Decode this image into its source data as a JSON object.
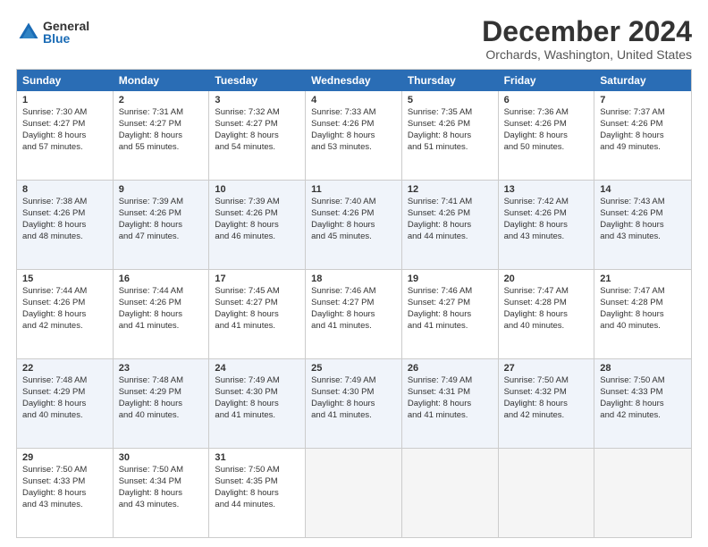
{
  "logo": {
    "general": "General",
    "blue": "Blue"
  },
  "title": "December 2024",
  "subtitle": "Orchards, Washington, United States",
  "header_days": [
    "Sunday",
    "Monday",
    "Tuesday",
    "Wednesday",
    "Thursday",
    "Friday",
    "Saturday"
  ],
  "rows": [
    [
      {
        "day": "1",
        "lines": [
          "Sunrise: 7:30 AM",
          "Sunset: 4:27 PM",
          "Daylight: 8 hours",
          "and 57 minutes."
        ]
      },
      {
        "day": "2",
        "lines": [
          "Sunrise: 7:31 AM",
          "Sunset: 4:27 PM",
          "Daylight: 8 hours",
          "and 55 minutes."
        ]
      },
      {
        "day": "3",
        "lines": [
          "Sunrise: 7:32 AM",
          "Sunset: 4:27 PM",
          "Daylight: 8 hours",
          "and 54 minutes."
        ]
      },
      {
        "day": "4",
        "lines": [
          "Sunrise: 7:33 AM",
          "Sunset: 4:26 PM",
          "Daylight: 8 hours",
          "and 53 minutes."
        ]
      },
      {
        "day": "5",
        "lines": [
          "Sunrise: 7:35 AM",
          "Sunset: 4:26 PM",
          "Daylight: 8 hours",
          "and 51 minutes."
        ]
      },
      {
        "day": "6",
        "lines": [
          "Sunrise: 7:36 AM",
          "Sunset: 4:26 PM",
          "Daylight: 8 hours",
          "and 50 minutes."
        ]
      },
      {
        "day": "7",
        "lines": [
          "Sunrise: 7:37 AM",
          "Sunset: 4:26 PM",
          "Daylight: 8 hours",
          "and 49 minutes."
        ]
      }
    ],
    [
      {
        "day": "8",
        "lines": [
          "Sunrise: 7:38 AM",
          "Sunset: 4:26 PM",
          "Daylight: 8 hours",
          "and 48 minutes."
        ]
      },
      {
        "day": "9",
        "lines": [
          "Sunrise: 7:39 AM",
          "Sunset: 4:26 PM",
          "Daylight: 8 hours",
          "and 47 minutes."
        ]
      },
      {
        "day": "10",
        "lines": [
          "Sunrise: 7:39 AM",
          "Sunset: 4:26 PM",
          "Daylight: 8 hours",
          "and 46 minutes."
        ]
      },
      {
        "day": "11",
        "lines": [
          "Sunrise: 7:40 AM",
          "Sunset: 4:26 PM",
          "Daylight: 8 hours",
          "and 45 minutes."
        ]
      },
      {
        "day": "12",
        "lines": [
          "Sunrise: 7:41 AM",
          "Sunset: 4:26 PM",
          "Daylight: 8 hours",
          "and 44 minutes."
        ]
      },
      {
        "day": "13",
        "lines": [
          "Sunrise: 7:42 AM",
          "Sunset: 4:26 PM",
          "Daylight: 8 hours",
          "and 43 minutes."
        ]
      },
      {
        "day": "14",
        "lines": [
          "Sunrise: 7:43 AM",
          "Sunset: 4:26 PM",
          "Daylight: 8 hours",
          "and 43 minutes."
        ]
      }
    ],
    [
      {
        "day": "15",
        "lines": [
          "Sunrise: 7:44 AM",
          "Sunset: 4:26 PM",
          "Daylight: 8 hours",
          "and 42 minutes."
        ]
      },
      {
        "day": "16",
        "lines": [
          "Sunrise: 7:44 AM",
          "Sunset: 4:26 PM",
          "Daylight: 8 hours",
          "and 41 minutes."
        ]
      },
      {
        "day": "17",
        "lines": [
          "Sunrise: 7:45 AM",
          "Sunset: 4:27 PM",
          "Daylight: 8 hours",
          "and 41 minutes."
        ]
      },
      {
        "day": "18",
        "lines": [
          "Sunrise: 7:46 AM",
          "Sunset: 4:27 PM",
          "Daylight: 8 hours",
          "and 41 minutes."
        ]
      },
      {
        "day": "19",
        "lines": [
          "Sunrise: 7:46 AM",
          "Sunset: 4:27 PM",
          "Daylight: 8 hours",
          "and 41 minutes."
        ]
      },
      {
        "day": "20",
        "lines": [
          "Sunrise: 7:47 AM",
          "Sunset: 4:28 PM",
          "Daylight: 8 hours",
          "and 40 minutes."
        ]
      },
      {
        "day": "21",
        "lines": [
          "Sunrise: 7:47 AM",
          "Sunset: 4:28 PM",
          "Daylight: 8 hours",
          "and 40 minutes."
        ]
      }
    ],
    [
      {
        "day": "22",
        "lines": [
          "Sunrise: 7:48 AM",
          "Sunset: 4:29 PM",
          "Daylight: 8 hours",
          "and 40 minutes."
        ]
      },
      {
        "day": "23",
        "lines": [
          "Sunrise: 7:48 AM",
          "Sunset: 4:29 PM",
          "Daylight: 8 hours",
          "and 40 minutes."
        ]
      },
      {
        "day": "24",
        "lines": [
          "Sunrise: 7:49 AM",
          "Sunset: 4:30 PM",
          "Daylight: 8 hours",
          "and 41 minutes."
        ]
      },
      {
        "day": "25",
        "lines": [
          "Sunrise: 7:49 AM",
          "Sunset: 4:30 PM",
          "Daylight: 8 hours",
          "and 41 minutes."
        ]
      },
      {
        "day": "26",
        "lines": [
          "Sunrise: 7:49 AM",
          "Sunset: 4:31 PM",
          "Daylight: 8 hours",
          "and 41 minutes."
        ]
      },
      {
        "day": "27",
        "lines": [
          "Sunrise: 7:50 AM",
          "Sunset: 4:32 PM",
          "Daylight: 8 hours",
          "and 42 minutes."
        ]
      },
      {
        "day": "28",
        "lines": [
          "Sunrise: 7:50 AM",
          "Sunset: 4:33 PM",
          "Daylight: 8 hours",
          "and 42 minutes."
        ]
      }
    ],
    [
      {
        "day": "29",
        "lines": [
          "Sunrise: 7:50 AM",
          "Sunset: 4:33 PM",
          "Daylight: 8 hours",
          "and 43 minutes."
        ]
      },
      {
        "day": "30",
        "lines": [
          "Sunrise: 7:50 AM",
          "Sunset: 4:34 PM",
          "Daylight: 8 hours",
          "and 43 minutes."
        ]
      },
      {
        "day": "31",
        "lines": [
          "Sunrise: 7:50 AM",
          "Sunset: 4:35 PM",
          "Daylight: 8 hours",
          "and 44 minutes."
        ]
      },
      {
        "day": "",
        "lines": []
      },
      {
        "day": "",
        "lines": []
      },
      {
        "day": "",
        "lines": []
      },
      {
        "day": "",
        "lines": []
      }
    ]
  ],
  "alt_rows": [
    1,
    3
  ]
}
